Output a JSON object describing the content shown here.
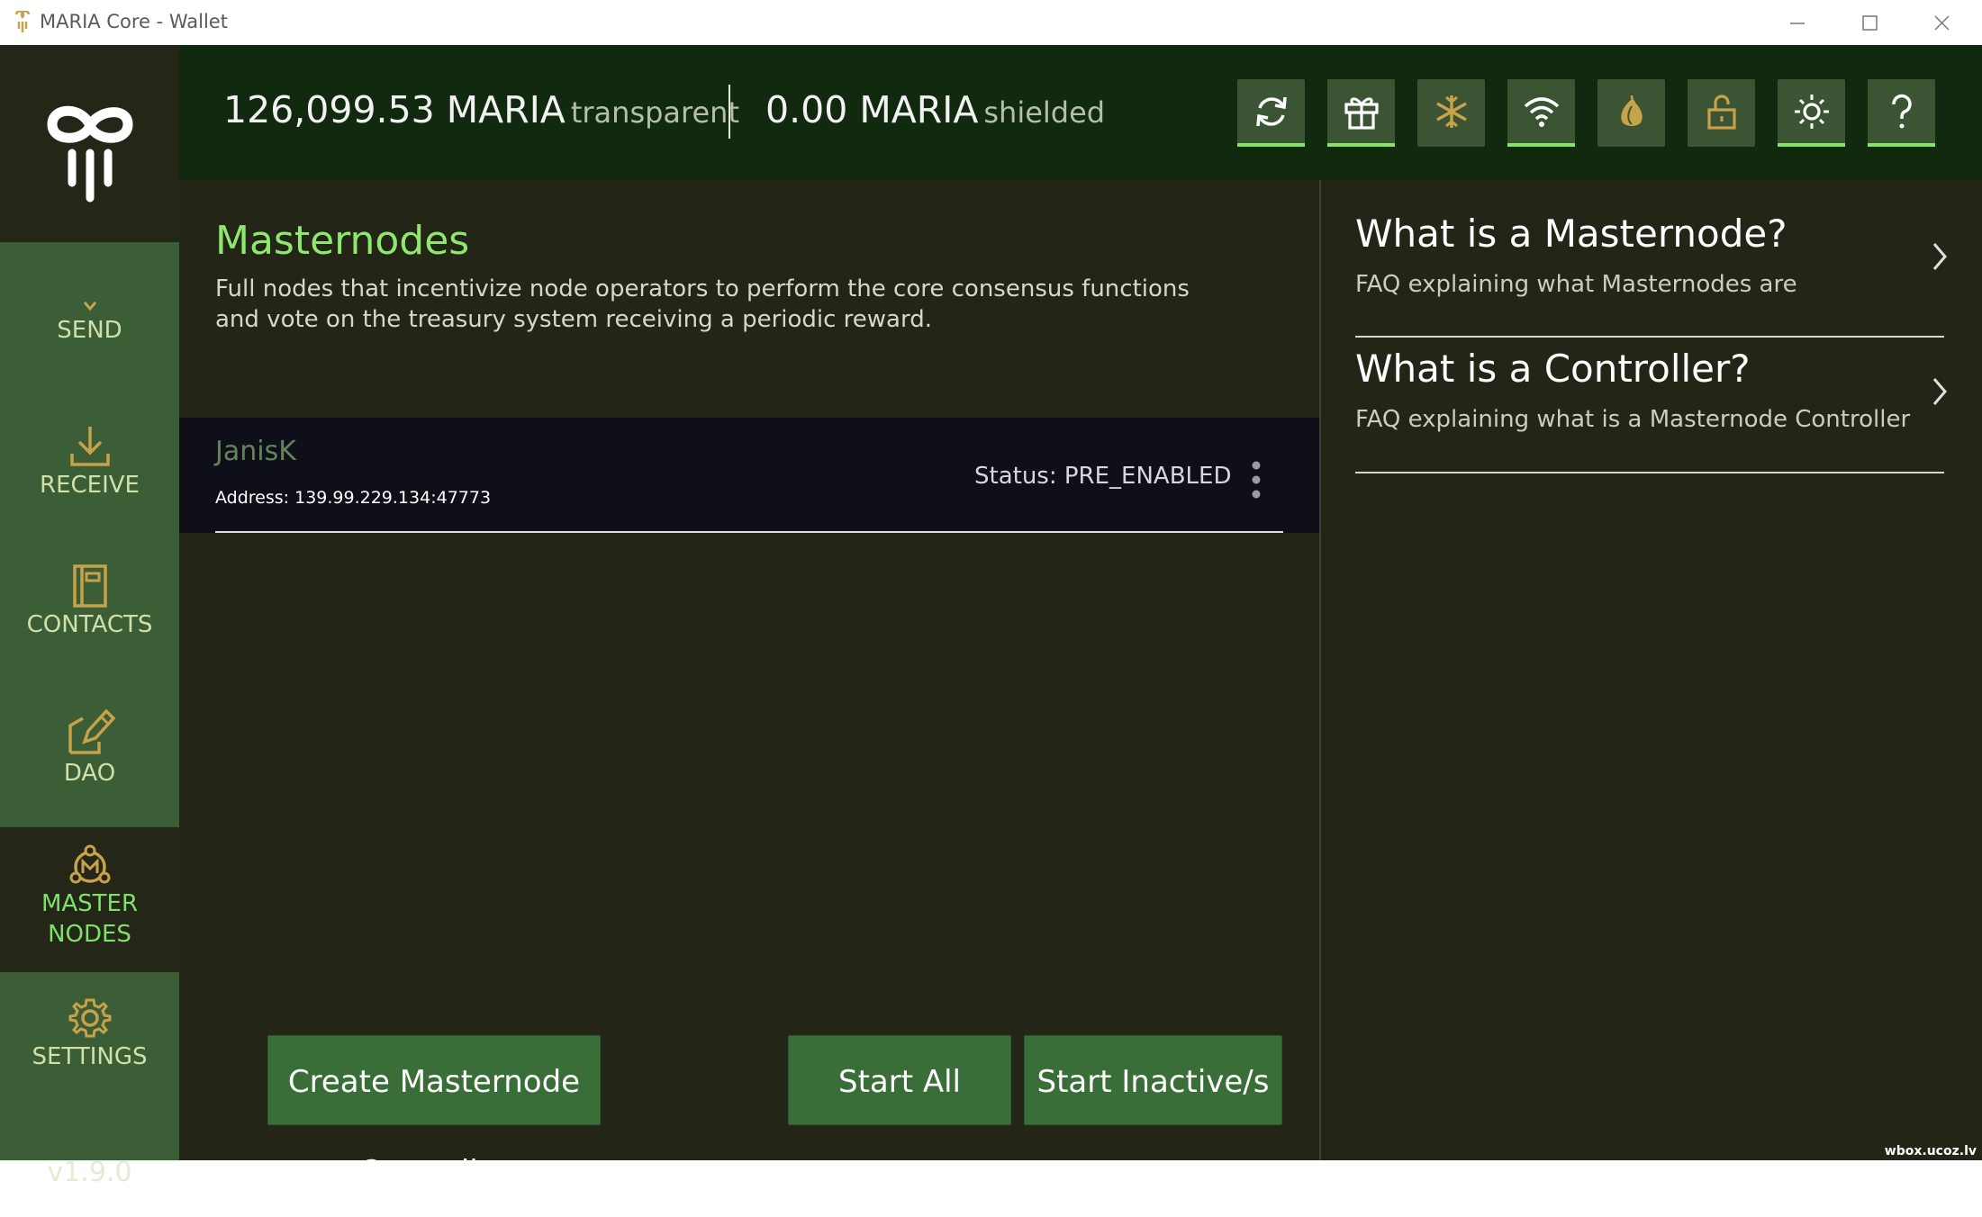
{
  "window": {
    "title": "MARIA Core - Wallet"
  },
  "sidebar": {
    "items": [
      {
        "label": "SEND",
        "icon": "chevron-down-icon"
      },
      {
        "label": "RECEIVE",
        "icon": "download-icon"
      },
      {
        "label": "CONTACTS",
        "icon": "contacts-book-icon"
      },
      {
        "label": "DAO",
        "icon": "edit-vote-icon"
      },
      {
        "label_line1": "MASTER",
        "label_line2": "NODES",
        "icon": "masternode-icon",
        "active": true
      },
      {
        "label": "SETTINGS",
        "icon": "gear-icon"
      }
    ],
    "version": "v1.9.0"
  },
  "header": {
    "transparent_amount": "126,099.53 MARIA",
    "transparent_label": "transparent",
    "shielded_amount": "0.00 MARIA",
    "shielded_label": "shielded",
    "buttons": [
      "sync-icon",
      "gift-icon",
      "snowflake-icon",
      "wifi-icon",
      "tor-onion-icon",
      "unlock-icon",
      "brightness-icon",
      "help-icon"
    ]
  },
  "main": {
    "title": "Masternodes",
    "description": "Full nodes that incentivize node operators to perform the core consensus functions and vote on the treasury system receiving a periodic reward.",
    "masternodes": [
      {
        "name": "JanisK",
        "address": "Address: 139.99.229.134:47773",
        "status": "Status: PRE_ENABLED"
      }
    ],
    "buttons": {
      "create": "Create Masternode Controller",
      "start_all": "Start All",
      "start_inactive": "Start Inactive/s"
    }
  },
  "faq": [
    {
      "title": "What is a Masternode?",
      "subtitle": "FAQ explaining what Masternodes are"
    },
    {
      "title": "What is a Controller?",
      "subtitle": "FAQ explaining what is a Masternode Controller"
    }
  ],
  "watermark": "wbox.ucoz.lv",
  "colors": {
    "accent_green": "#8ee86f",
    "sidebar_bg": "#3b5e37",
    "header_bg": "#10290f",
    "panel_bg": "#232517",
    "button_bg": "#3a6e39",
    "icon_gold": "#c8a24a"
  }
}
